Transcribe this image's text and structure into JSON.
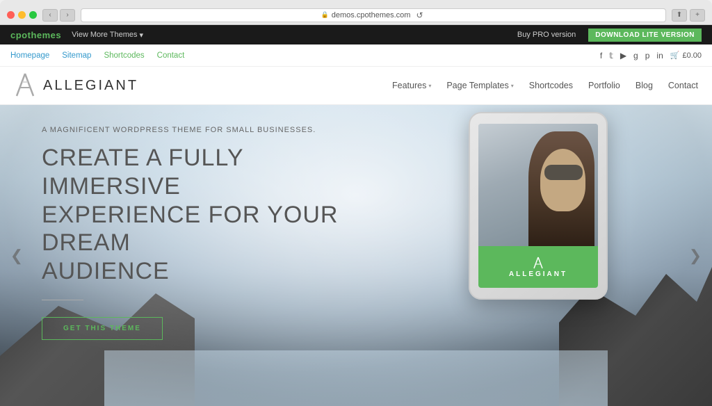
{
  "browser": {
    "url": "demos.cpothemes.com",
    "back_btn": "‹",
    "forward_btn": "›",
    "reload": "↺"
  },
  "admin_bar": {
    "brand": "cpothemes",
    "view_themes": "View More Themes",
    "dropdown_arrow": "▾",
    "buy_pro": "Buy PRO version",
    "download_lite": "DOWNLOAD LITE VERSION"
  },
  "secondary_nav": {
    "links": [
      {
        "label": "Homepage",
        "color": "blue"
      },
      {
        "label": "Sitemap",
        "color": "blue"
      },
      {
        "label": "Shortcodes",
        "color": "green"
      },
      {
        "label": "Contact",
        "color": "green"
      }
    ],
    "social_icons": [
      "f",
      "t",
      "▶",
      "g+",
      "p",
      "in"
    ],
    "cart_icon": "🛒",
    "cart_amount": "£0.00"
  },
  "header": {
    "logo_text": "ALLEGIANT",
    "nav_items": [
      {
        "label": "Features",
        "has_dropdown": true
      },
      {
        "label": "Page Templates",
        "has_dropdown": true
      },
      {
        "label": "Shortcodes",
        "has_dropdown": false
      },
      {
        "label": "Portfolio",
        "has_dropdown": false
      },
      {
        "label": "Blog",
        "has_dropdown": false
      },
      {
        "label": "Contact",
        "has_dropdown": false
      }
    ]
  },
  "hero": {
    "tagline": "A MAGNIFICENT WORDPRESS THEME FOR SMALL BUSINESSES.",
    "heading_line1": "CREATE A FULLY IMMERSIVE",
    "heading_line2": "EXPERIENCE FOR YOUR DREAM",
    "heading_line3": "AUDIENCE",
    "cta_button": "GET THIS THEME",
    "prev_arrow": "❮",
    "next_arrow": "❯"
  },
  "tablet": {
    "theme_name": "ALLEGIANT",
    "camera_dot": "·"
  }
}
